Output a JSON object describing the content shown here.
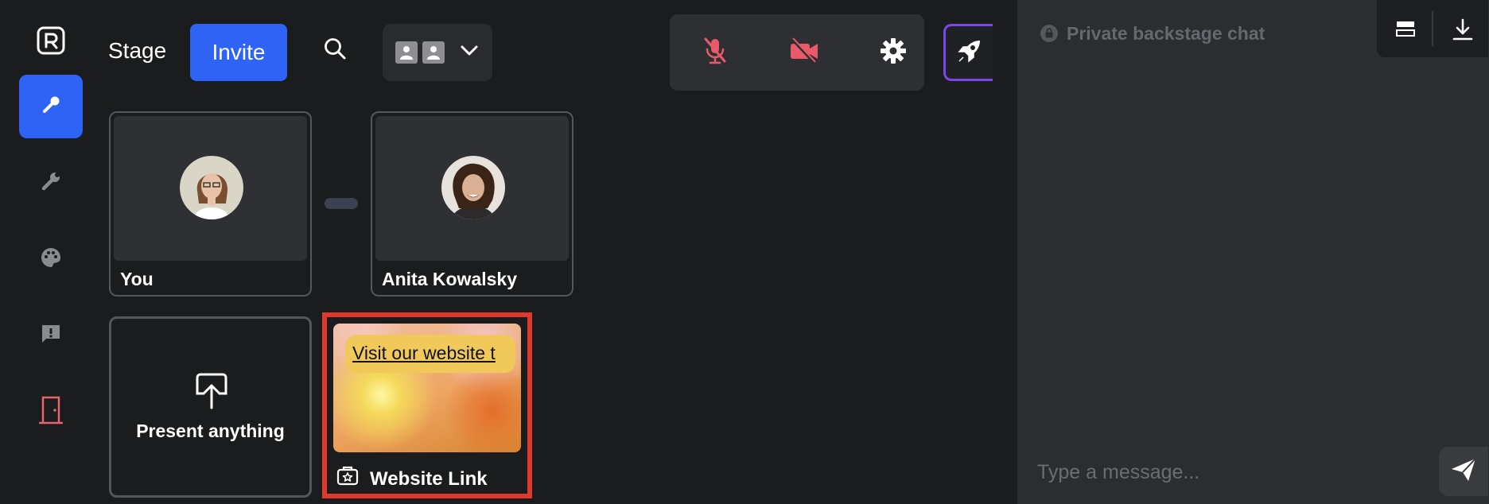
{
  "app": {
    "logo_icon": "r-logo-icon",
    "accent_color": "#2f63f5"
  },
  "rail": {
    "items": [
      {
        "name": "microphone-icon",
        "active": true
      },
      {
        "name": "wrench-icon",
        "active": false
      },
      {
        "name": "palette-icon",
        "active": false
      },
      {
        "name": "feedback-icon",
        "active": false
      },
      {
        "name": "exit-door-icon",
        "active": false
      }
    ]
  },
  "header": {
    "stage_label": "Stage",
    "invite_label": "Invite",
    "search_icon": "search-icon",
    "layout_icon": "participants-layout-icon"
  },
  "controls": {
    "mic": {
      "icon": "mic-muted-icon",
      "color": "#e85a6a"
    },
    "camera": {
      "icon": "camera-off-icon",
      "color": "#e85a6a"
    },
    "settings": {
      "icon": "gear-icon"
    },
    "go_live": {
      "icon": "rocket-icon"
    }
  },
  "stage": {
    "participants": [
      {
        "name": "You"
      },
      {
        "name": "Anita Kowalsky"
      }
    ],
    "present_label": "Present anything",
    "website_tile": {
      "link_text": "Visit our website t",
      "label": "Website Link"
    }
  },
  "chat": {
    "title": "Private backstage chat",
    "placeholder": "Type a message...",
    "lock_icon": "lock-icon",
    "send_icon": "send-icon"
  }
}
